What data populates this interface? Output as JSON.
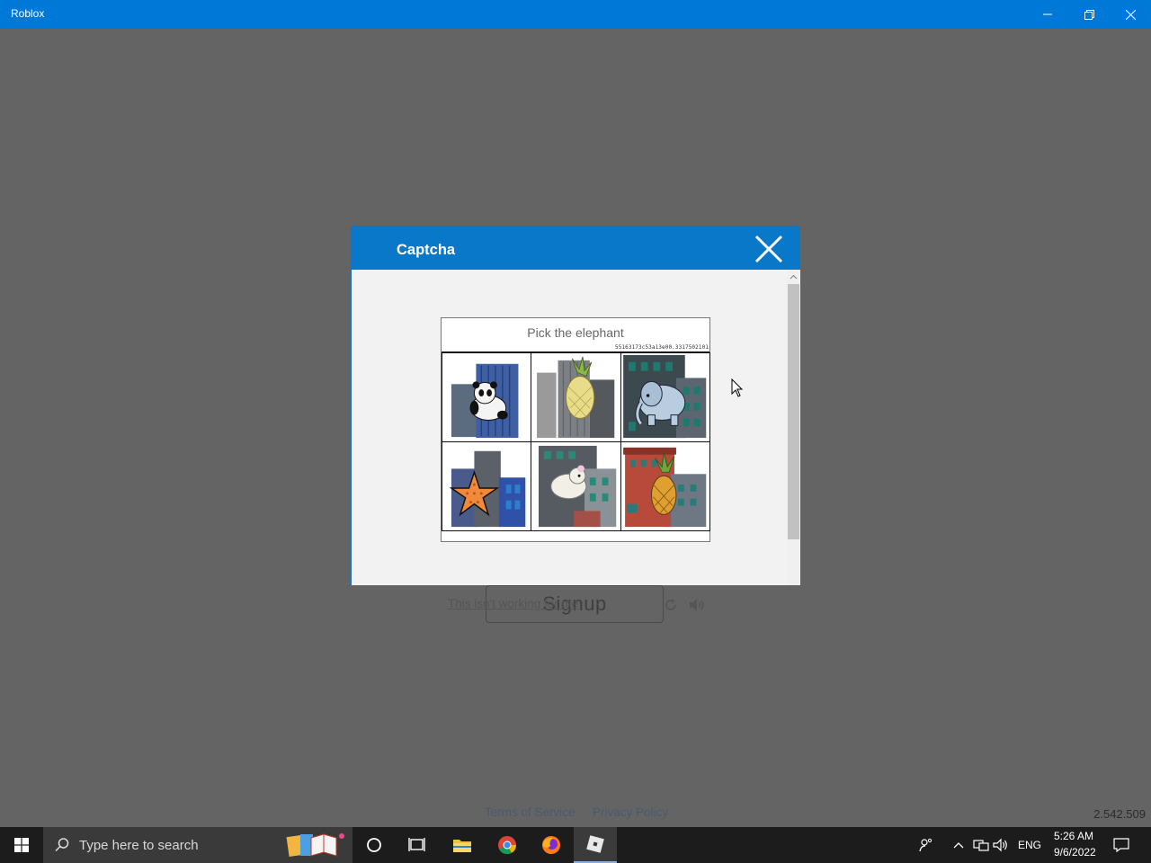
{
  "window": {
    "title": "Roblox"
  },
  "background": {
    "signup_label": "Signup",
    "terms_link": "Terms of Service",
    "privacy_link": "Privacy Policy",
    "version": "2.542.509"
  },
  "dialog": {
    "title": "Captcha",
    "prompt": "Pick the elephant",
    "captcha_id": "55163173c53a13e00.3317502101",
    "tiles": [
      {
        "animal": "panda"
      },
      {
        "animal": "pineapple"
      },
      {
        "animal": "elephant"
      },
      {
        "animal": "starfish"
      },
      {
        "animal": "sheep"
      },
      {
        "animal": "pineapple"
      }
    ],
    "not_working_link": "This isn't working for me",
    "icons": {
      "reload": "reload-icon",
      "audio": "audio-icon",
      "close": "close-icon"
    }
  },
  "taskbar": {
    "search_placeholder": "Type here to search",
    "language": "ENG",
    "time": "5:26 AM",
    "date": "9/6/2022"
  },
  "colors": {
    "titlebar": "#0078d7",
    "dialog_header": "#0a78c8",
    "background": "#646464",
    "taskbar": "#1c1c1c"
  }
}
